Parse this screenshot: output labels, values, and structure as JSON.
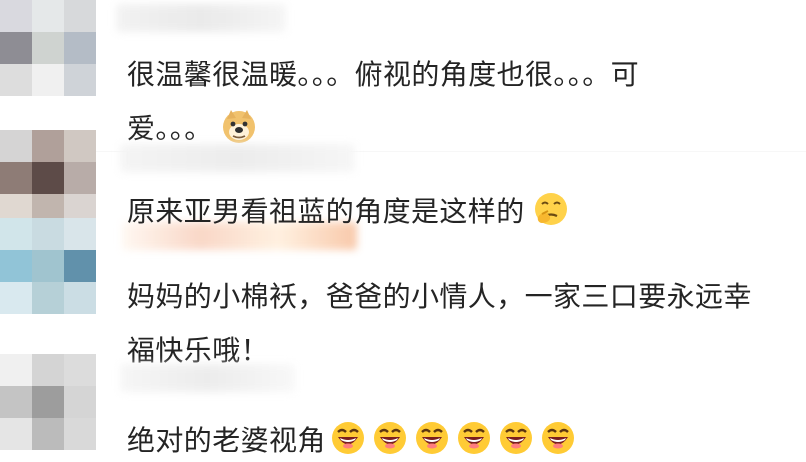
{
  "comments": [
    {
      "text_line1": "很温馨很温暖。。。俯视的角度也很。。。可",
      "text_line2": "爱。。。",
      "emoji": "doge-icon"
    },
    {
      "text": "原来亚男看祖蓝的角度是这样的",
      "emoji": "thinking-face-icon"
    },
    {
      "text_line1": "妈妈的小棉袄，爸爸的小情人，一家三口要永远幸",
      "text_line2": "福快乐哦！"
    },
    {
      "text": "绝对的老婆视角",
      "emoji": "laughing-face-icon",
      "emoji_count": 6
    }
  ]
}
